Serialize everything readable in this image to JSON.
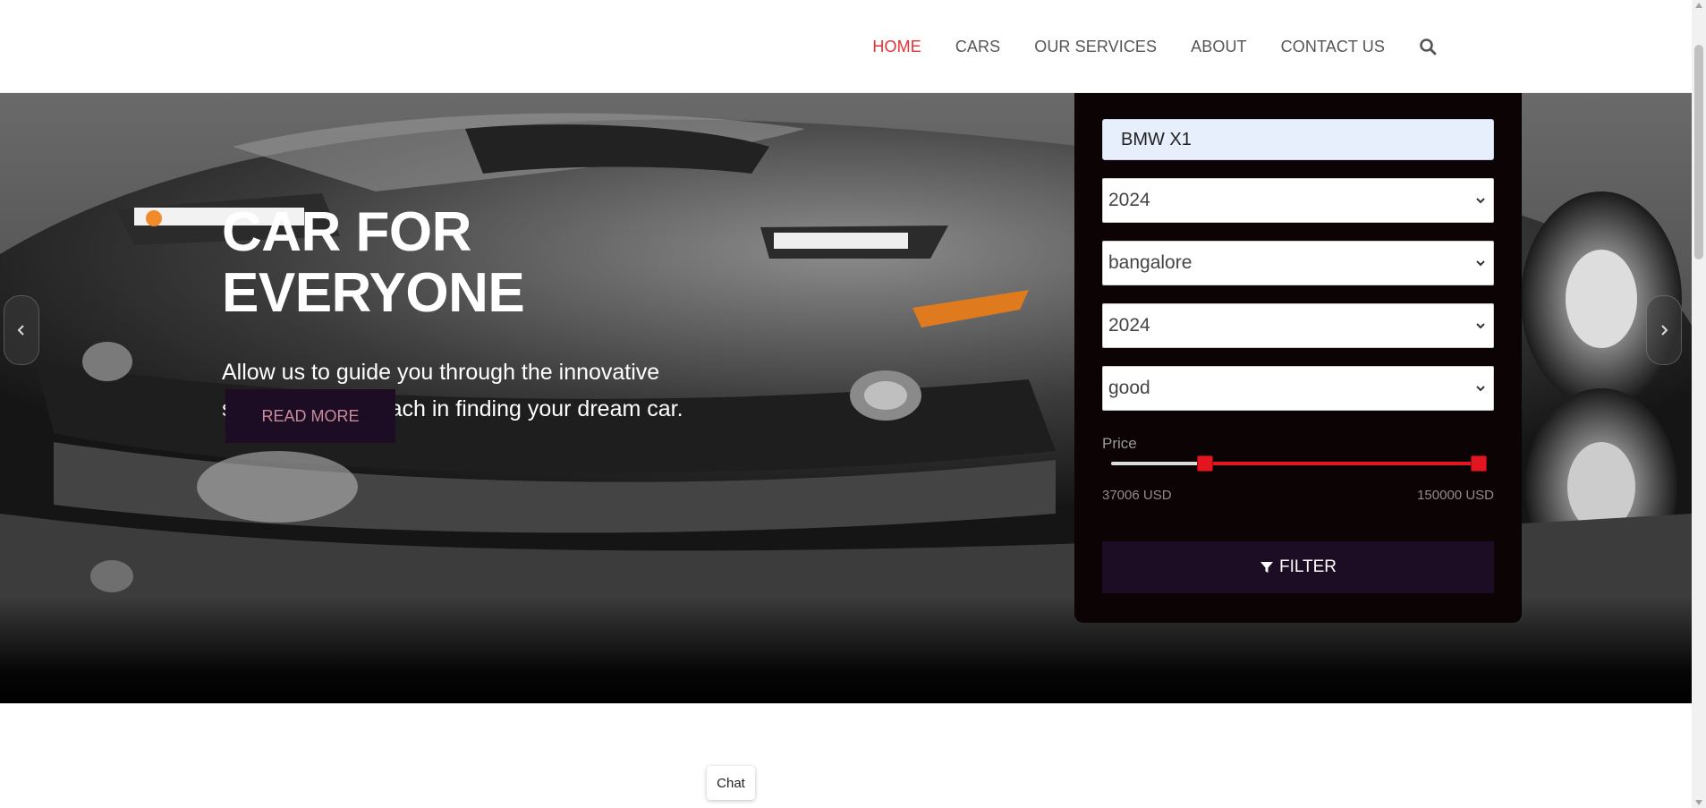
{
  "nav": {
    "items": [
      {
        "label": "HOME",
        "active": true
      },
      {
        "label": "CARS",
        "active": false
      },
      {
        "label": "OUR SERVICES",
        "active": false
      },
      {
        "label": "ABOUT",
        "active": false
      },
      {
        "label": "CONTACT US",
        "active": false
      }
    ],
    "search_icon": "search-icon",
    "active_color": "#e53035"
  },
  "hero": {
    "title": "CAR FOR EVERYONE",
    "subtitle": "Allow us to guide you through the innovative stress free approach in finding your dream car.",
    "read_more_label": "READ MORE",
    "prev_icon": "chevron-left-icon",
    "next_icon": "chevron-right-icon"
  },
  "filter": {
    "model_value": "BMW X1",
    "selects": [
      {
        "name": "year-from",
        "value": "2024"
      },
      {
        "name": "location",
        "value": "bangalore"
      },
      {
        "name": "year-to",
        "value": "2024"
      },
      {
        "name": "condition",
        "value": "good"
      }
    ],
    "price_label": "Price",
    "price_min": "37006 USD",
    "price_max": "150000 USD",
    "range_min_fraction": 0.24,
    "range_max_fraction": 1.0,
    "button_label": "FILTER",
    "button_icon": "filter-icon",
    "accent_color": "#e3161f"
  },
  "chat": {
    "label": "Chat"
  }
}
